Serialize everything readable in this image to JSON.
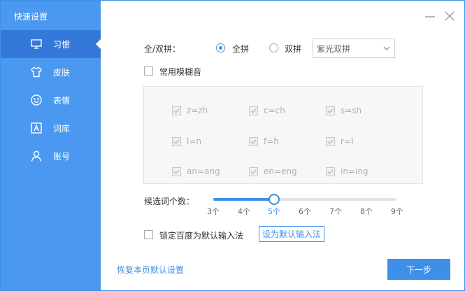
{
  "window": {
    "title": "快速设置"
  },
  "sidebar": {
    "items": [
      {
        "label": "习惯",
        "icon": "monitor-icon",
        "active": true
      },
      {
        "label": "皮肤",
        "icon": "tshirt-icon",
        "active": false
      },
      {
        "label": "表情",
        "icon": "smiley-icon",
        "active": false
      },
      {
        "label": "词库",
        "icon": "letter-a-icon",
        "active": false
      },
      {
        "label": "账号",
        "icon": "user-icon",
        "active": false
      }
    ]
  },
  "pinyin": {
    "label": "全/双拼：",
    "full_label": "全拼",
    "double_label": "双拼",
    "selected": "全拼",
    "scheme_value": "紫光双拼"
  },
  "fuzzy": {
    "label": "常用模糊音",
    "items": [
      [
        "z=zh",
        "c=ch",
        "s=sh"
      ],
      [
        "l=n",
        "f=h",
        "r=l"
      ],
      [
        "an=ang",
        "en=eng",
        "in=ing"
      ]
    ]
  },
  "candidates": {
    "label": "候选词个数：",
    "ticks": [
      "3个",
      "4个",
      "5个",
      "6个",
      "7个",
      "8个",
      "9个"
    ],
    "value": "5个",
    "value_fraction": 0.3333
  },
  "lock": {
    "label": "锁定百度为默认输入法",
    "set_default_label": "设为默认输入法"
  },
  "footer": {
    "restore_label": "恢复本页默认设置",
    "next_label": "下一步"
  },
  "colors": {
    "accent": "#3d8fe8",
    "sidebar": "#4a98f0",
    "sidebar_active": "#3479d9"
  }
}
